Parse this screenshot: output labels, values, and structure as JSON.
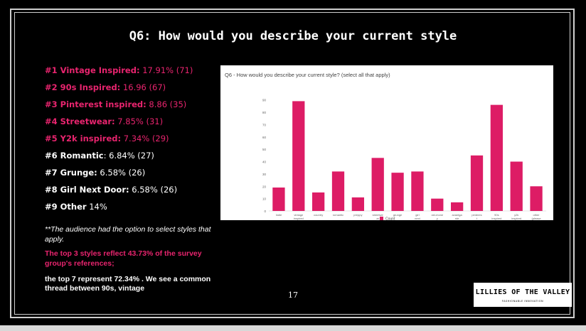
{
  "slide": {
    "title": "Q6: How would you describe your current style",
    "rankings": [
      {
        "label": "#1 Vintage Inspired:",
        "value": " 17.91% (71)",
        "emphasis": "pink"
      },
      {
        "label": "#2 90s Inspired:",
        "value": " 16.96 (67)",
        "emphasis": "pink"
      },
      {
        "label": "#3 Pinterest inspired:",
        "value": " 8.86 (35)",
        "emphasis": "pink"
      },
      {
        "label": "#4 Streetwear:",
        "value": " 7.85% (31)",
        "emphasis": "pink"
      },
      {
        "label": "#5 Y2k inspired:",
        "value": " 7.34% (29)",
        "emphasis": "pink"
      },
      {
        "label": "#6 Romantic",
        "value": ": 6.84% (27)",
        "emphasis": "white"
      },
      {
        "label": "#7 Grunge:",
        "value": " 6.58% (26)",
        "emphasis": "white"
      },
      {
        "label": "#8 Girl Next Door:",
        "value": " 6.58% (26)",
        "emphasis": "white"
      },
      {
        "label": "#9 Other",
        "value": " 14%",
        "emphasis": "white"
      }
    ],
    "note": "**The audience had the option to select styles that apply.",
    "highlight": "The top 3 styles reflect 43.73% of the survey group's references;",
    "highlight2": "the top 7 represent 72.34% . We see a common thread between 90s, vintage",
    "page_number": "17",
    "logo_text": "LILLIES OF THE VALLEY",
    "logo_subtext": "FASHIONABLE INNOVATION"
  },
  "colors": {
    "accent": "#e8246e",
    "bar": "#dd1c65",
    "background": "#000000"
  },
  "chart_data": {
    "type": "bar",
    "title": "Q6 - How would you describe your current style? (select all that apply)",
    "categories": [
      "Indie",
      "vintage inspired",
      "country",
      "romantic",
      "preppy",
      "streetwear",
      "grunge",
      "girl next door",
      "old-money",
      "avantgarde",
      "pinterest inspired",
      "90s inspired",
      "y2k inspired",
      "other (please specify)"
    ],
    "category_lines": [
      [
        "Indie"
      ],
      [
        "vintage",
        "inspired"
      ],
      [
        "country"
      ],
      [
        "romantic"
      ],
      [
        "preppy"
      ],
      [
        "streetwe",
        "ar"
      ],
      [
        "grunge"
      ],
      [
        "girl",
        "next",
        "door"
      ],
      [
        "old-mone",
        "y"
      ],
      [
        "avantga",
        "rde"
      ],
      [
        "pinteres",
        "t",
        "inspired"
      ],
      [
        "90s",
        "inspired"
      ],
      [
        "y2k",
        "inspired"
      ],
      [
        "other",
        "(please",
        "specify)"
      ]
    ],
    "series": [
      {
        "name": "Count",
        "values": [
          19,
          89,
          15,
          32,
          11,
          43,
          31,
          32,
          10,
          7,
          45,
          86,
          40,
          20
        ]
      }
    ],
    "ylim": [
      0,
      95
    ],
    "yticks": [
      0,
      10,
      20,
      30,
      40,
      50,
      60,
      70,
      80,
      90
    ],
    "grid": false,
    "legend": "bottom"
  }
}
